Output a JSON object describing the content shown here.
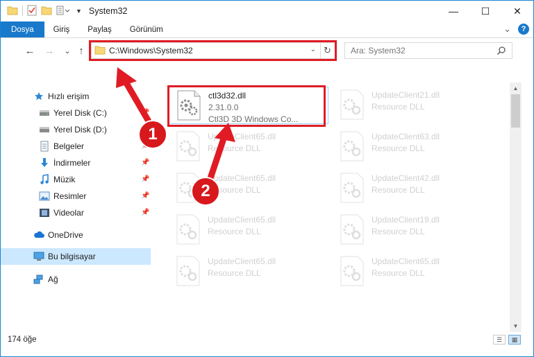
{
  "window": {
    "title": "System32",
    "controls": {
      "minimize": "—",
      "maximize": "☐",
      "close": "✕"
    }
  },
  "ribbon": {
    "tabs": [
      "Dosya",
      "Giriş",
      "Paylaş",
      "Görünüm"
    ],
    "collapse_glyph": "⌄",
    "help_glyph": "?"
  },
  "nav": {
    "back": "←",
    "forward": "→",
    "recent": "⌄",
    "up": "↑",
    "address_path": "C:\\Windows\\System32",
    "dropdown": "⌄",
    "refresh": "↻",
    "search_placeholder": "Ara: System32"
  },
  "sidebar": {
    "items": [
      {
        "label": "Hızlı erişim",
        "icon": "star-icon"
      },
      {
        "label": "Yerel Disk (C:)",
        "icon": "drive-icon"
      },
      {
        "label": "Yerel Disk (D:)",
        "icon": "drive-icon"
      },
      {
        "label": "Belgeler",
        "icon": "documents-icon"
      },
      {
        "label": "İndirmeler",
        "icon": "download-icon"
      },
      {
        "label": "Müzik",
        "icon": "music-icon"
      },
      {
        "label": "Resimler",
        "icon": "pictures-icon"
      },
      {
        "label": "Videolar",
        "icon": "videos-icon"
      },
      {
        "label": "OneDrive",
        "icon": "cloud-icon"
      },
      {
        "label": "Bu bilgisayar",
        "icon": "computer-icon"
      },
      {
        "label": "Ağ",
        "icon": "network-icon"
      }
    ],
    "pin_glyph": "📌"
  },
  "files": [
    {
      "name": "ctl3d32.dll",
      "line2": "2.31.0.0",
      "line3": "Ctl3D 3D Windows Co..."
    },
    {
      "name": "UpdateClient21.dll",
      "line2": "Resource DLL"
    },
    {
      "name": "UpdateClient65.dll",
      "line2": "Resource DLL"
    },
    {
      "name": "UpdateClient63.dll",
      "line2": "Resource DLL"
    },
    {
      "name": "UpdateClient65.dll",
      "line2": "Resource DLL"
    },
    {
      "name": "UpdateClient42.dll",
      "line2": "Resource DLL"
    },
    {
      "name": "UpdateClient65.dll",
      "line2": "Resource DLL"
    },
    {
      "name": "UpdateClient19.dll",
      "line2": "Resource DLL"
    },
    {
      "name": "UpdateClient65.dll",
      "line2": "Resource DLL"
    },
    {
      "name": "UpdateClient65.dll",
      "line2": "Resource DLL"
    }
  ],
  "status": {
    "count": "174 öğe"
  },
  "annotations": {
    "step1": "1",
    "step2": "2",
    "color": "#e01b24"
  }
}
